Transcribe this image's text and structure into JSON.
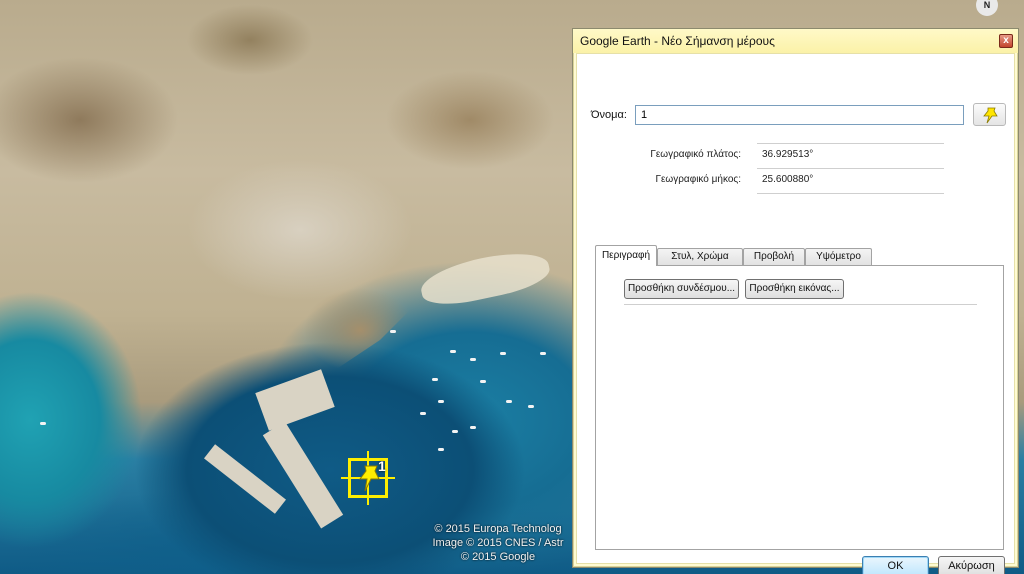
{
  "map": {
    "copyright_lines": [
      "© 2015 Europa Technolog",
      "Image © 2015 CNES / Astr",
      "© 2015 Google"
    ],
    "compass_letter": "N",
    "placemark_label": "1"
  },
  "dialog": {
    "title": "Google Earth - Νέο Σήμανση μέρους",
    "close_glyph": "x",
    "name_label": "Όνομα:",
    "name_value": "1",
    "latitude_label": "Γεωγραφικό πλάτος:",
    "latitude_value": "36.929513°",
    "longitude_label": "Γεωγραφικό μήκος:",
    "longitude_value": "25.600880°",
    "tabs": [
      {
        "label": "Περιγραφή",
        "active": true
      },
      {
        "label": "Στυλ, Χρώμα",
        "active": false
      },
      {
        "label": "Προβολή",
        "active": false
      },
      {
        "label": "Υψόμετρο",
        "active": false
      }
    ],
    "add_link_label": "Προσθήκη συνδέσμου...",
    "add_image_label": "Προσθήκη εικόνας...",
    "ok_label": "OK",
    "cancel_label": "Ακύρωση",
    "pin_icon": "yellow-pushpin-icon"
  },
  "colors": {
    "placemark": "#ffee00",
    "dialog_frame": "#fffbd2"
  }
}
